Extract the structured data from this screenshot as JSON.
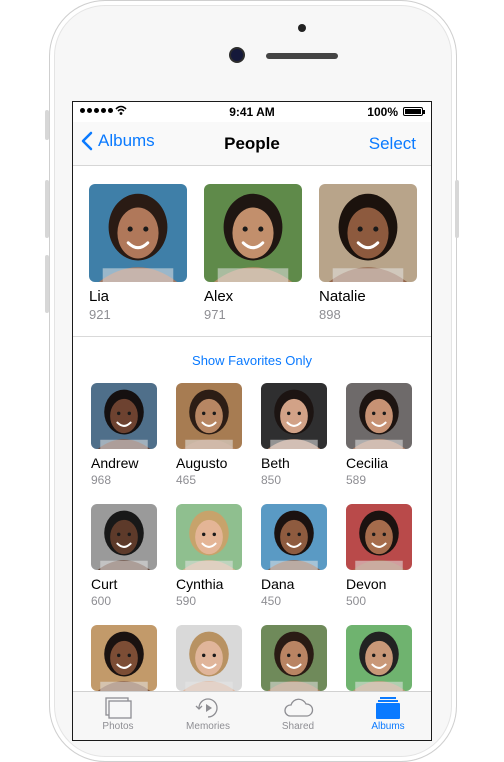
{
  "status_bar": {
    "time": "9:41 AM",
    "battery": "100%",
    "signal_icon": "signal-dots-icon",
    "wifi_icon": "wifi-icon",
    "battery_level": 1.0
  },
  "nav": {
    "back_label": "Albums",
    "title": "People",
    "select_label": "Select"
  },
  "favorites": [
    {
      "name": "Lia",
      "count": "921",
      "bg": "#3f7fa8",
      "skin": "#b0785a",
      "hair": "#2a1b14"
    },
    {
      "name": "Alex",
      "count": "971",
      "bg": "#5f8a4a",
      "skin": "#c28f6c",
      "hair": "#1f1612"
    },
    {
      "name": "Natalie",
      "count": "898",
      "bg": "#b8a48a",
      "skin": "#8d5a3e",
      "hair": "#1b120d"
    }
  ],
  "show_favorites_label": "Show Favorites Only",
  "people": [
    {
      "name": "Andrew",
      "count": "968",
      "bg": "#4f6f8a",
      "skin": "#6d4230",
      "hair": "#151010"
    },
    {
      "name": "Augusto",
      "count": "465",
      "bg": "#a77c52",
      "skin": "#b78663",
      "hair": "#2c1d15"
    },
    {
      "name": "Beth",
      "count": "850",
      "bg": "#2f2f30",
      "skin": "#d2a287",
      "hair": "#1c1412"
    },
    {
      "name": "Cecilia",
      "count": "589",
      "bg": "#6e6a6a",
      "skin": "#c79274",
      "hair": "#1d1411"
    },
    {
      "name": "Curt",
      "count": "600",
      "bg": "#9a9a9a",
      "skin": "#5d3a2a",
      "hair": "#181818"
    },
    {
      "name": "Cynthia",
      "count": "590",
      "bg": "#8fbf8f",
      "skin": "#e4b596",
      "hair": "#c7a36b"
    },
    {
      "name": "Dana",
      "count": "450",
      "bg": "#5a9ac4",
      "skin": "#8e5b3f",
      "hair": "#1b1210"
    },
    {
      "name": "Devon",
      "count": "500",
      "bg": "#b94a4a",
      "skin": "#a66c4c",
      "hair": "#1b1210"
    },
    {
      "name": "",
      "count": "",
      "bg": "#c29a6a",
      "skin": "#7c4d35",
      "hair": "#1a1210"
    },
    {
      "name": "",
      "count": "",
      "bg": "#d9d9d9",
      "skin": "#e0b59a",
      "hair": "#b89262"
    },
    {
      "name": "",
      "count": "",
      "bg": "#6f8a5a",
      "skin": "#b98463",
      "hair": "#2a1b14"
    },
    {
      "name": "",
      "count": "",
      "bg": "#6fb36f",
      "skin": "#c99878",
      "hair": "#222222"
    }
  ],
  "tabs": [
    {
      "label": "Photos",
      "icon": "photos-icon",
      "active": false
    },
    {
      "label": "Memories",
      "icon": "memories-icon",
      "active": false
    },
    {
      "label": "Shared",
      "icon": "shared-cloud-icon",
      "active": false
    },
    {
      "label": "Albums",
      "icon": "albums-icon",
      "active": true
    }
  ],
  "colors": {
    "accent": "#0a7aff",
    "secondary_text": "#8e8e93"
  }
}
